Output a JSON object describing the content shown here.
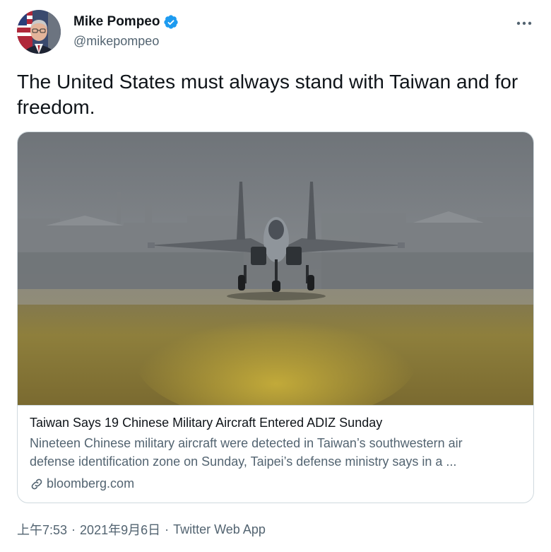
{
  "author": {
    "display_name": "Mike Pompeo",
    "handle": "@mikepompeo",
    "verified": true,
    "verified_color": "#1d9bf0"
  },
  "tweet": {
    "text": "The United States must always stand with Taiwan and for freedom."
  },
  "card": {
    "title": "Taiwan Says 19 Chinese Military Aircraft Entered ADIZ Sunday",
    "description": "Nineteen Chinese military aircraft were detected in Taiwan’s southwestern air\ndefense identification zone on Sunday, Taipei’s defense ministry says in a ...",
    "domain": "bloomberg.com"
  },
  "meta": {
    "time": "上午7:53",
    "date": "2021年9月6日",
    "separator": "·",
    "source": "Twitter Web App"
  },
  "icons": {
    "more": "more-horizontal-icon",
    "link": "link-icon",
    "verified": "verified-badge-icon"
  }
}
